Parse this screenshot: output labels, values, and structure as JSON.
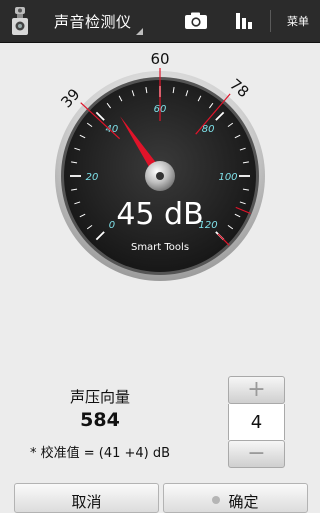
{
  "actionbar": {
    "title": "声音检测仪",
    "menu_label": "菜单",
    "icons": {
      "app": "sound-meter-app-icon",
      "camera": "camera-icon",
      "chart": "bar-chart-icon"
    }
  },
  "gauge": {
    "marker_min_label": "39",
    "marker_mid_label": "60",
    "marker_max_label": "78",
    "scale_labels": [
      "0",
      "20",
      "40",
      "60",
      "80",
      "100",
      "120"
    ],
    "reading_text": "45 dB",
    "brand": "Smart Tools",
    "needle_value": 45,
    "scale_min": 0,
    "scale_max": 120,
    "colors": {
      "face": "#1c1c1c",
      "ticks": "#ffffff",
      "labels": "#7fe0e8",
      "needle": "#e0142a",
      "markers": "#e0142a"
    }
  },
  "reading": {
    "label": "声压向量",
    "value": "584",
    "calibration": "* 校准值 = (41 +4) dB"
  },
  "stepper": {
    "plus": "+",
    "value": "4",
    "minus": "−"
  },
  "buttons": {
    "cancel": "取消",
    "ok": "确定"
  }
}
